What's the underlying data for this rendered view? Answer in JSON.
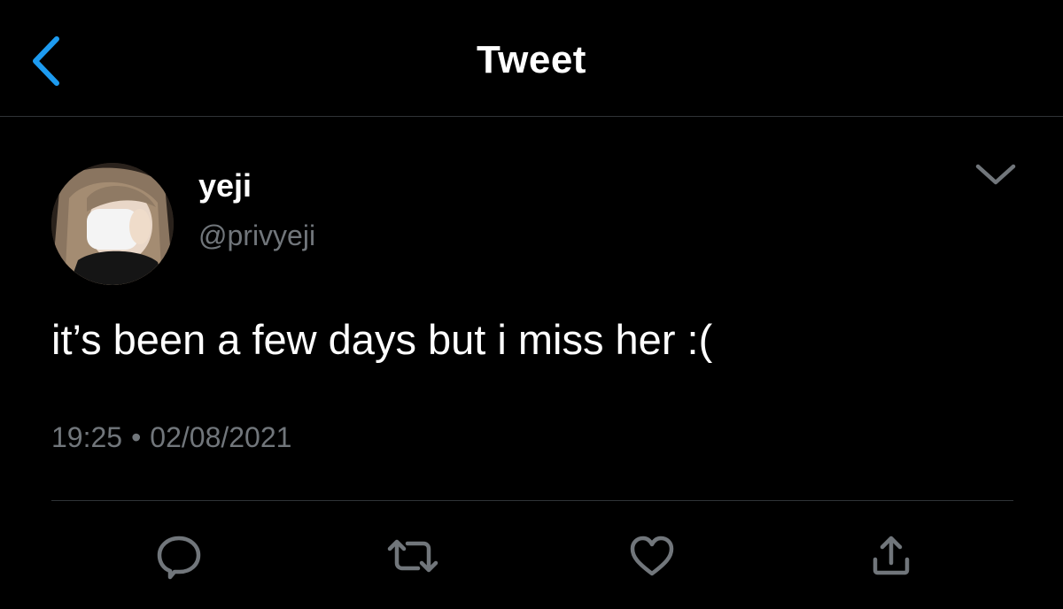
{
  "header": {
    "title": "Tweet",
    "back_icon": "chevron-left-icon"
  },
  "tweet": {
    "author": {
      "display_name": "yeji",
      "handle": "@privyeji"
    },
    "text": "it’s been a few days but i miss her :(",
    "time": "19:25",
    "separator": "•",
    "date": "02/08/2021",
    "more_icon": "chevron-down-icon"
  },
  "actions": [
    {
      "icon": "reply-icon"
    },
    {
      "icon": "retweet-icon"
    },
    {
      "icon": "like-icon"
    },
    {
      "icon": "share-icon"
    }
  ],
  "colors": {
    "background": "#000000",
    "accent": "#1d9bf0",
    "text": "#ffffff",
    "secondary_text": "#71767b",
    "divider": "#2f3336"
  }
}
